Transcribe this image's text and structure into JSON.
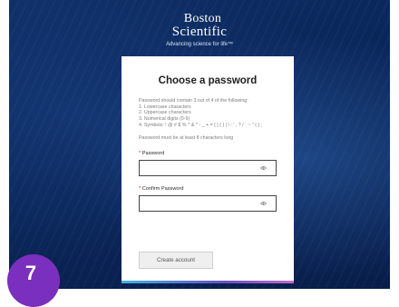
{
  "brand": {
    "name_line1": "Boston",
    "name_line2": "Scientific",
    "tagline": "Advancing science for life™"
  },
  "form": {
    "title": "Choose a password",
    "rules_intro": "Password should contain 3 out of 4 of the following:",
    "rules": [
      "1. Lowercase characters",
      "2. Uppercase characters",
      "3. Numerical digits (0-9)",
      "4. Symbols: ! @ # $ % ^ & * - _ + = [ ] { } | \\ : ' , ? / ` ~ \" ( ) ;"
    ],
    "min_length_note": "Password must be at least 8 characters long",
    "password_label": "Password",
    "password_value": "",
    "confirm_label": "Confirm Password",
    "confirm_value": "",
    "required_marker": "*",
    "submit_label": "Create account"
  },
  "step_badge": "7",
  "icons": {
    "password_toggle": "eye-icon",
    "confirm_toggle": "eye-icon"
  },
  "colors": {
    "background": "#0a2659",
    "badge": "#7b2fbe",
    "required": "#c62828"
  }
}
